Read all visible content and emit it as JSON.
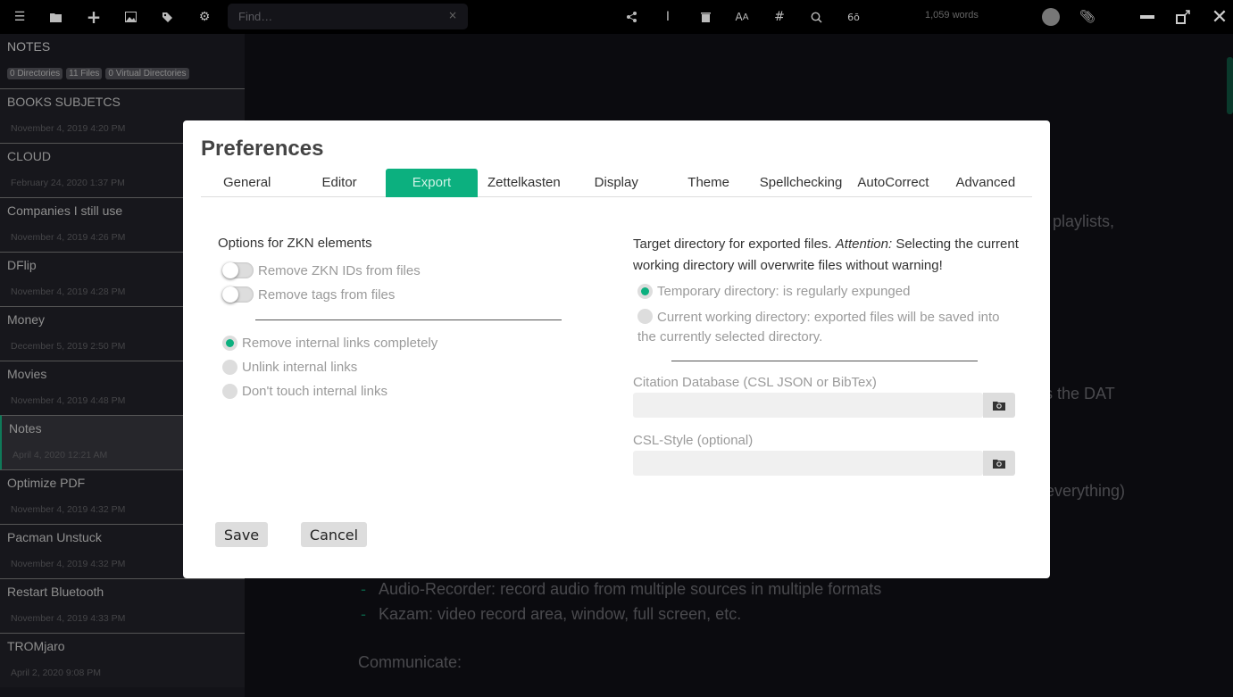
{
  "toolbar": {
    "find_placeholder": "Find…",
    "find_clear": "×",
    "word_count": "1,059 words",
    "left_icons": [
      "menu-icon",
      "open-folder-icon",
      "new-file-icon",
      "image-icon",
      "tag-icon",
      "gear-icon"
    ],
    "right_icons": [
      "share-icon",
      "text-cursor-icon",
      "trash-icon",
      "font-size-icon",
      "hashtag-icon",
      "search-icon",
      "glasses-icon"
    ]
  },
  "sidebar": {
    "title": "NOTES",
    "badges": [
      "0 Directories",
      "11 Files",
      "0 Virtual Directories"
    ],
    "items": [
      {
        "name": "BOOKS SUBJETCS",
        "date": "November 4, 2019 4:20 PM"
      },
      {
        "name": "CLOUD",
        "date": "February 24, 2020 1:37 PM"
      },
      {
        "name": "Companies I still use",
        "date": "November 4, 2019 4:26 PM"
      },
      {
        "name": "DFlip",
        "date": "November 4, 2019 4:28 PM"
      },
      {
        "name": "Money",
        "date": "December 5, 2019 2:50 PM"
      },
      {
        "name": "Movies",
        "date": "November 4, 2019 4:48 PM"
      },
      {
        "name": "Notes",
        "date": "April 4, 2020 12:21 AM",
        "active": true
      },
      {
        "name": "Optimize PDF",
        "date": "November 4, 2019 4:32 PM"
      },
      {
        "name": "Pacman Unstuck",
        "date": "November 4, 2019 4:32 PM"
      },
      {
        "name": "Restart Bluetooth",
        "date": "November 4, 2019 4:33 PM"
      },
      {
        "name": "TROMjaro",
        "date": "April 2, 2020 9:08 PM"
      }
    ]
  },
  "editor": {
    "fragments": [
      "playlists,",
      "s the DAT",
      "everything)"
    ],
    "list": [
      "Audio-Recorder: record audio from multiple sources in multiple formats",
      "Kazam: video record area, window, full screen, etc."
    ],
    "bullet": "-",
    "heading": "Communicate:"
  },
  "modal": {
    "title": "Preferences",
    "tabs": [
      "General",
      "Editor",
      "Export",
      "Zettelkasten",
      "Display",
      "Theme",
      "Spellchecking",
      "AutoCorrect",
      "Advanced"
    ],
    "active_tab": "Export",
    "zkn": {
      "label": "Options for ZKN elements",
      "toggles": [
        {
          "label": "Remove ZKN IDs from files",
          "on": false
        },
        {
          "label": "Remove tags from files",
          "on": false
        }
      ],
      "radios": [
        {
          "label": "Remove internal links completely",
          "checked": true
        },
        {
          "label": "Unlink internal links",
          "checked": false
        },
        {
          "label": "Don't touch internal links",
          "checked": false
        }
      ]
    },
    "target": {
      "label_a": "Target directory for exported files. ",
      "label_em": "Attention:",
      "label_b": " Selecting the current working directory will overwrite files without warning!",
      "radios": [
        {
          "label": "Temporary directory: is regularly expunged",
          "checked": true
        },
        {
          "label": "Current working directory: exported files will be saved into the currently selected directory.",
          "checked": false
        }
      ]
    },
    "citation_label": "Citation Database (CSL JSON or BibTex)",
    "citation_value": "",
    "csl_label": "CSL-Style (optional)",
    "csl_value": "",
    "save": "Save",
    "cancel": "Cancel"
  },
  "colors": {
    "accent": "#0cb07f",
    "toolbar": "#000000",
    "sidebar": "#131318"
  }
}
